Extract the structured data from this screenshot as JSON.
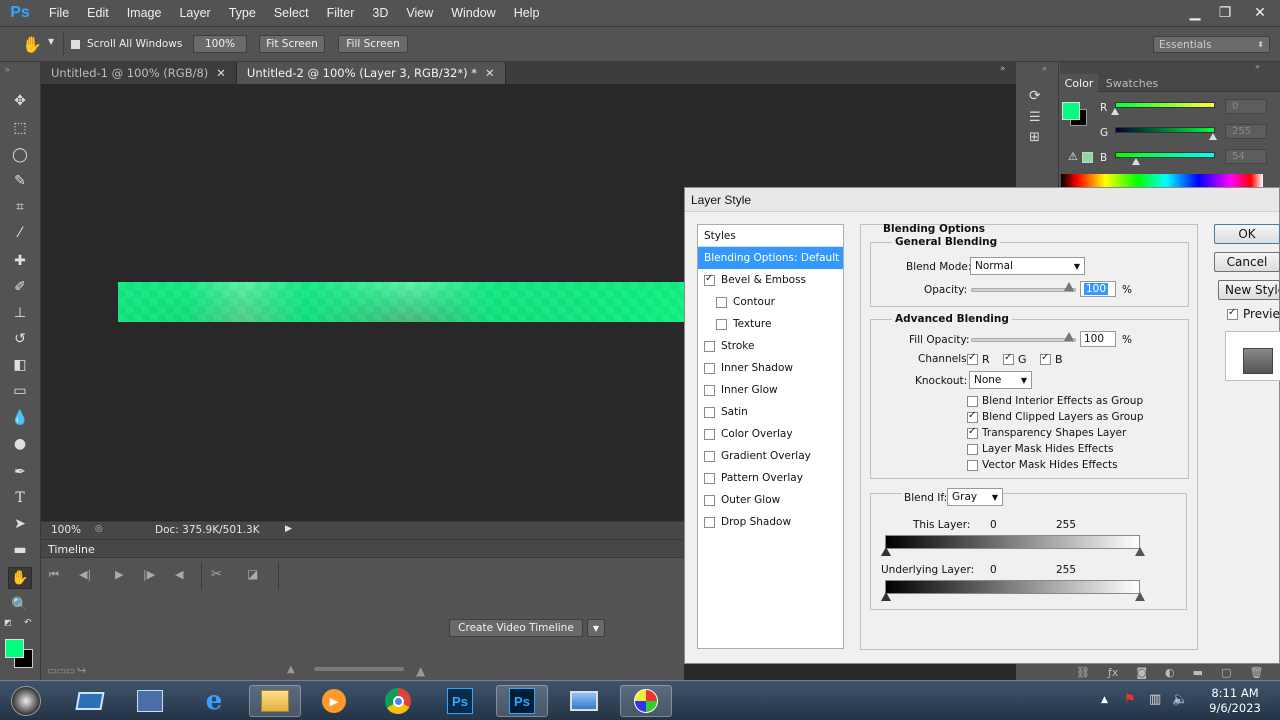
{
  "app": {
    "logo": "Ps"
  },
  "menu": [
    "File",
    "Edit",
    "Image",
    "Layer",
    "Type",
    "Select",
    "Filter",
    "3D",
    "View",
    "Window",
    "Help"
  ],
  "options_bar": {
    "scroll_all_label": "Scroll All Windows",
    "zoom_btn": "100%",
    "fit_screen": "Fit Screen",
    "fill_screen": "Fill Screen",
    "workspace": "Essentials"
  },
  "tabs": [
    {
      "label": "Untitled-1 @ 100% (RGB/8)"
    },
    {
      "label": "Untitled-2 @ 100% (Layer 3, RGB/32*) *"
    }
  ],
  "status": {
    "zoom": "100%",
    "doc": "Doc: 375.9K/501.3K"
  },
  "timeline": {
    "title": "Timeline",
    "create_btn": "Create Video Timeline"
  },
  "color_panel": {
    "tabs": [
      "Color",
      "Swatches"
    ],
    "labels": [
      "R",
      "G",
      "B"
    ],
    "values": [
      "0",
      "255",
      "54"
    ],
    "slider_fracs": [
      0.0,
      1.0,
      0.21
    ],
    "fg_color": "#00ff80"
  },
  "dialog": {
    "title": "Layer Style",
    "styles_header": "Styles",
    "styles": [
      {
        "label": "Blending Options: Default",
        "checkbox": false,
        "checked": false,
        "selected": true,
        "indent": false
      },
      {
        "label": "Bevel & Emboss",
        "checkbox": true,
        "checked": true,
        "selected": false,
        "indent": false
      },
      {
        "label": "Contour",
        "checkbox": true,
        "checked": false,
        "selected": false,
        "indent": true
      },
      {
        "label": "Texture",
        "checkbox": true,
        "checked": false,
        "selected": false,
        "indent": true
      },
      {
        "label": "Stroke",
        "checkbox": true,
        "checked": false,
        "selected": false,
        "indent": false
      },
      {
        "label": "Inner Shadow",
        "checkbox": true,
        "checked": false,
        "selected": false,
        "indent": false
      },
      {
        "label": "Inner Glow",
        "checkbox": true,
        "checked": false,
        "selected": false,
        "indent": false
      },
      {
        "label": "Satin",
        "checkbox": true,
        "checked": false,
        "selected": false,
        "indent": false
      },
      {
        "label": "Color Overlay",
        "checkbox": true,
        "checked": false,
        "selected": false,
        "indent": false
      },
      {
        "label": "Gradient Overlay",
        "checkbox": true,
        "checked": false,
        "selected": false,
        "indent": false
      },
      {
        "label": "Pattern Overlay",
        "checkbox": true,
        "checked": false,
        "selected": false,
        "indent": false
      },
      {
        "label": "Outer Glow",
        "checkbox": true,
        "checked": false,
        "selected": false,
        "indent": false
      },
      {
        "label": "Drop Shadow",
        "checkbox": true,
        "checked": false,
        "selected": false,
        "indent": false
      }
    ],
    "blending_options_title": "Blending Options",
    "general_title": "General Blending",
    "blend_mode_label": "Blend Mode:",
    "blend_mode_value": "Normal",
    "opacity_label": "Opacity:",
    "opacity_value": "100",
    "percent": "%",
    "advanced_title": "Advanced Blending",
    "fill_opacity_label": "Fill Opacity:",
    "fill_opacity_value": "100",
    "channels_label": "Channels:",
    "channels": [
      "R",
      "G",
      "B"
    ],
    "knockout_label": "Knockout:",
    "knockout_value": "None",
    "options": [
      {
        "label": "Blend Interior Effects as Group",
        "checked": false
      },
      {
        "label": "Blend Clipped Layers as Group",
        "checked": true
      },
      {
        "label": "Transparency Shapes Layer",
        "checked": true
      },
      {
        "label": "Layer Mask Hides Effects",
        "checked": false
      },
      {
        "label": "Vector Mask Hides Effects",
        "checked": false
      }
    ],
    "blend_if_label": "Blend If:",
    "blend_if_value": "Gray",
    "this_layer_label": "This Layer:",
    "underlying_label": "Underlying Layer:",
    "range_min": "0",
    "range_max": "255",
    "buttons": {
      "ok": "OK",
      "cancel": "Cancel",
      "new_style": "New Style...",
      "preview": "Preview"
    }
  },
  "taskbar": {
    "time": "8:11 AM",
    "date": "9/6/2023"
  }
}
